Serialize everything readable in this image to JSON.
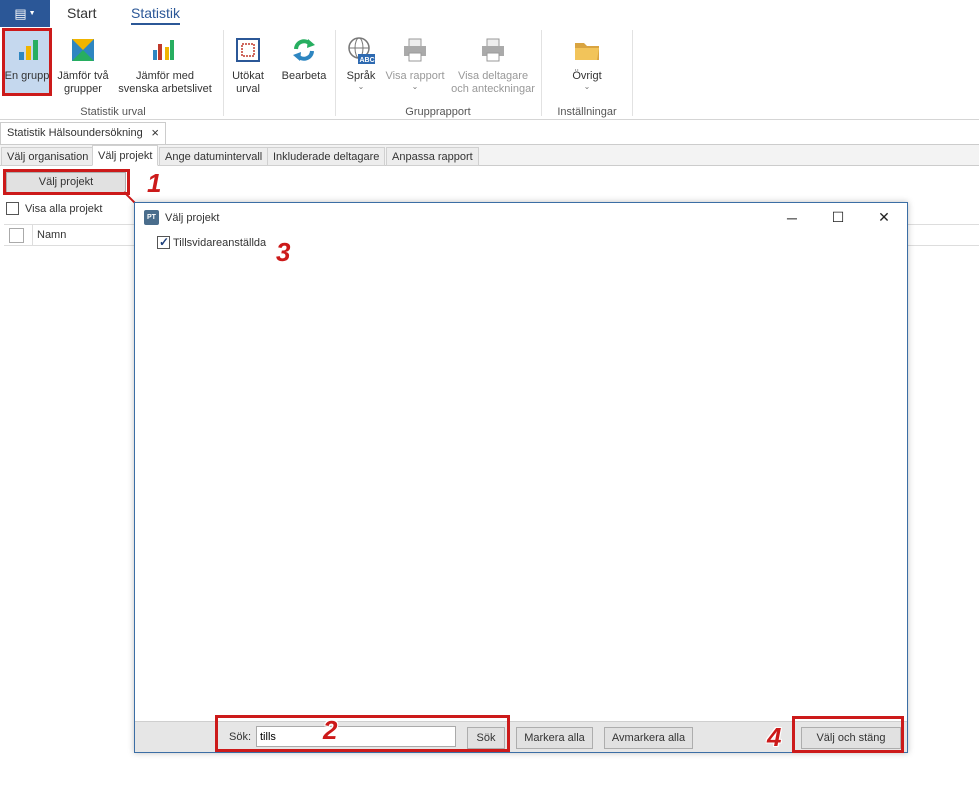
{
  "ribbon": {
    "tabs": [
      "Start",
      "Statistik"
    ],
    "buttons": {
      "en_grupp": "En grupp",
      "jamfor_tva": "Jämför två grupper",
      "jamfor_svenska": "Jämför med svenska arbetslivet",
      "utokat": "Utökat urval",
      "bearbeta": "Bearbeta",
      "sprak": "Språk",
      "visa_rapport": "Visa rapport",
      "visa_deltagare": "Visa deltagare och anteckningar",
      "ovrigt": "Övrigt"
    },
    "groups": {
      "urval": "Statistik urval",
      "grupprapport": "Grupprapport",
      "installningar": "Inställningar"
    }
  },
  "document": {
    "tab_title": "Statistik Hälsoundersökning",
    "inner_tabs": [
      "Välj organisation",
      "Välj projekt",
      "Ange datumintervall",
      "Inkluderade deltagare",
      "Anpassa rapport"
    ],
    "valj_projekt_button": "Välj projekt",
    "visa_alla_label": "Visa alla projekt",
    "column_namn": "Namn"
  },
  "dialog": {
    "title": "Välj projekt",
    "icon_text": "PT",
    "items": [
      {
        "label": "Tillsvidareanställda",
        "checked": true
      }
    ],
    "footer": {
      "sok_label": "Sök:",
      "search_value": "tills",
      "sok_button": "Sök",
      "markera_alla": "Markera alla",
      "avmarkera_alla": "Avmarkera alla",
      "valj_och_stang": "Välj och stäng"
    }
  },
  "annotations": {
    "n1": "1",
    "n2": "2",
    "n3": "3",
    "n4": "4"
  },
  "colors": {
    "accent": "#2b5797",
    "highlight": "#cc1a1a"
  }
}
